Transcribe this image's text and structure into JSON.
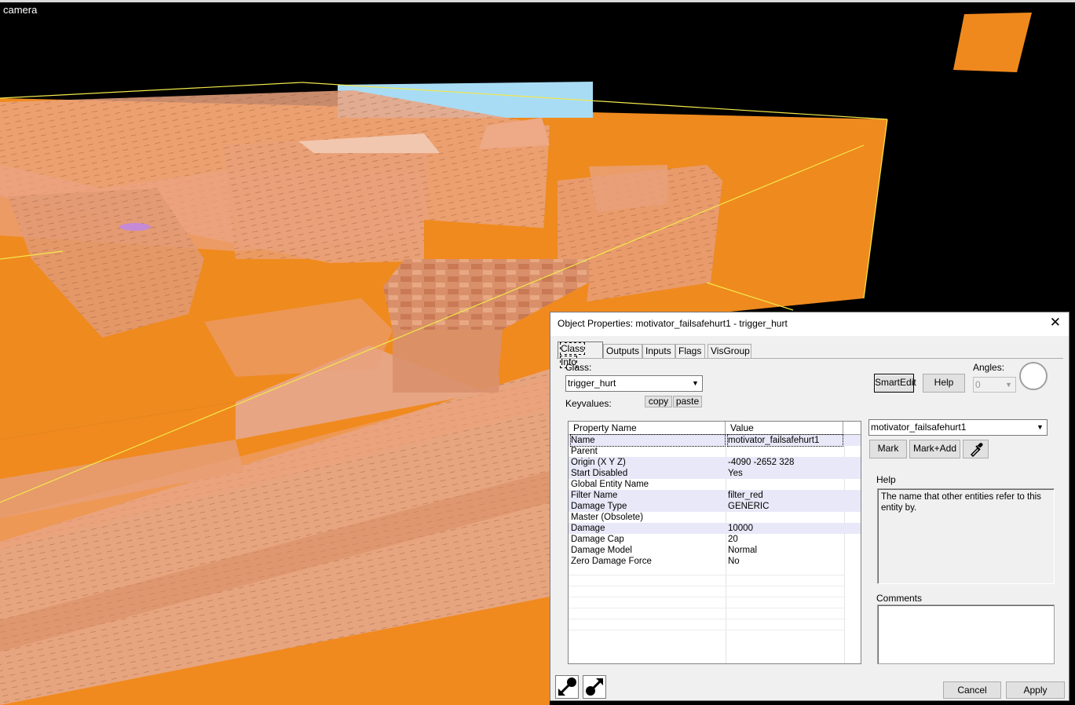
{
  "viewport": {
    "label": "camera"
  },
  "dialog": {
    "title": "Object Properties: motivator_failsafehurt1 - trigger_hurt",
    "tabs": [
      "Class Info",
      "Outputs",
      "Inputs",
      "Flags",
      "VisGroup"
    ],
    "class_label": "Class:",
    "class_value": "trigger_hurt",
    "keyvalues_label": "Keyvalues:",
    "copy_label": "copy",
    "paste_label": "paste",
    "smartedit_label": "SmartEdit",
    "help_button_label": "Help",
    "angles_label": "Angles:",
    "angles_value": "0",
    "grid": {
      "headers": [
        "Property Name",
        "Value"
      ],
      "rows": [
        {
          "name": "Name",
          "value": "motivator_failsafehurt1"
        },
        {
          "name": "Parent",
          "value": ""
        },
        {
          "name": "Origin (X Y Z)",
          "value": "-4090 -2652 328"
        },
        {
          "name": "Start Disabled",
          "value": "Yes"
        },
        {
          "name": "Global Entity Name",
          "value": ""
        },
        {
          "name": "Filter Name",
          "value": "filter_red"
        },
        {
          "name": "Damage Type",
          "value": "GENERIC"
        },
        {
          "name": "Master (Obsolete)",
          "value": ""
        },
        {
          "name": "Damage",
          "value": "10000"
        },
        {
          "name": "Damage Cap",
          "value": "20"
        },
        {
          "name": "Damage Model",
          "value": "Normal"
        },
        {
          "name": "Zero Damage Force",
          "value": "No"
        }
      ]
    },
    "name_combo_value": "motivator_failsafehurt1",
    "mark_label": "Mark",
    "markadd_label": "Mark+Add",
    "help_section_label": "Help",
    "help_text": "The name that other entities refer to this entity by.",
    "comments_label": "Comments",
    "comments_value": "",
    "cancel_label": "Cancel",
    "apply_label": "Apply"
  },
  "colors": {
    "viewport_bg": "#000000",
    "brush_orange": "#f08a1e",
    "brush_light": "#e8a583",
    "dialog_bg": "#f0f0f0",
    "grid_alt_row": "#e8e8f8"
  }
}
